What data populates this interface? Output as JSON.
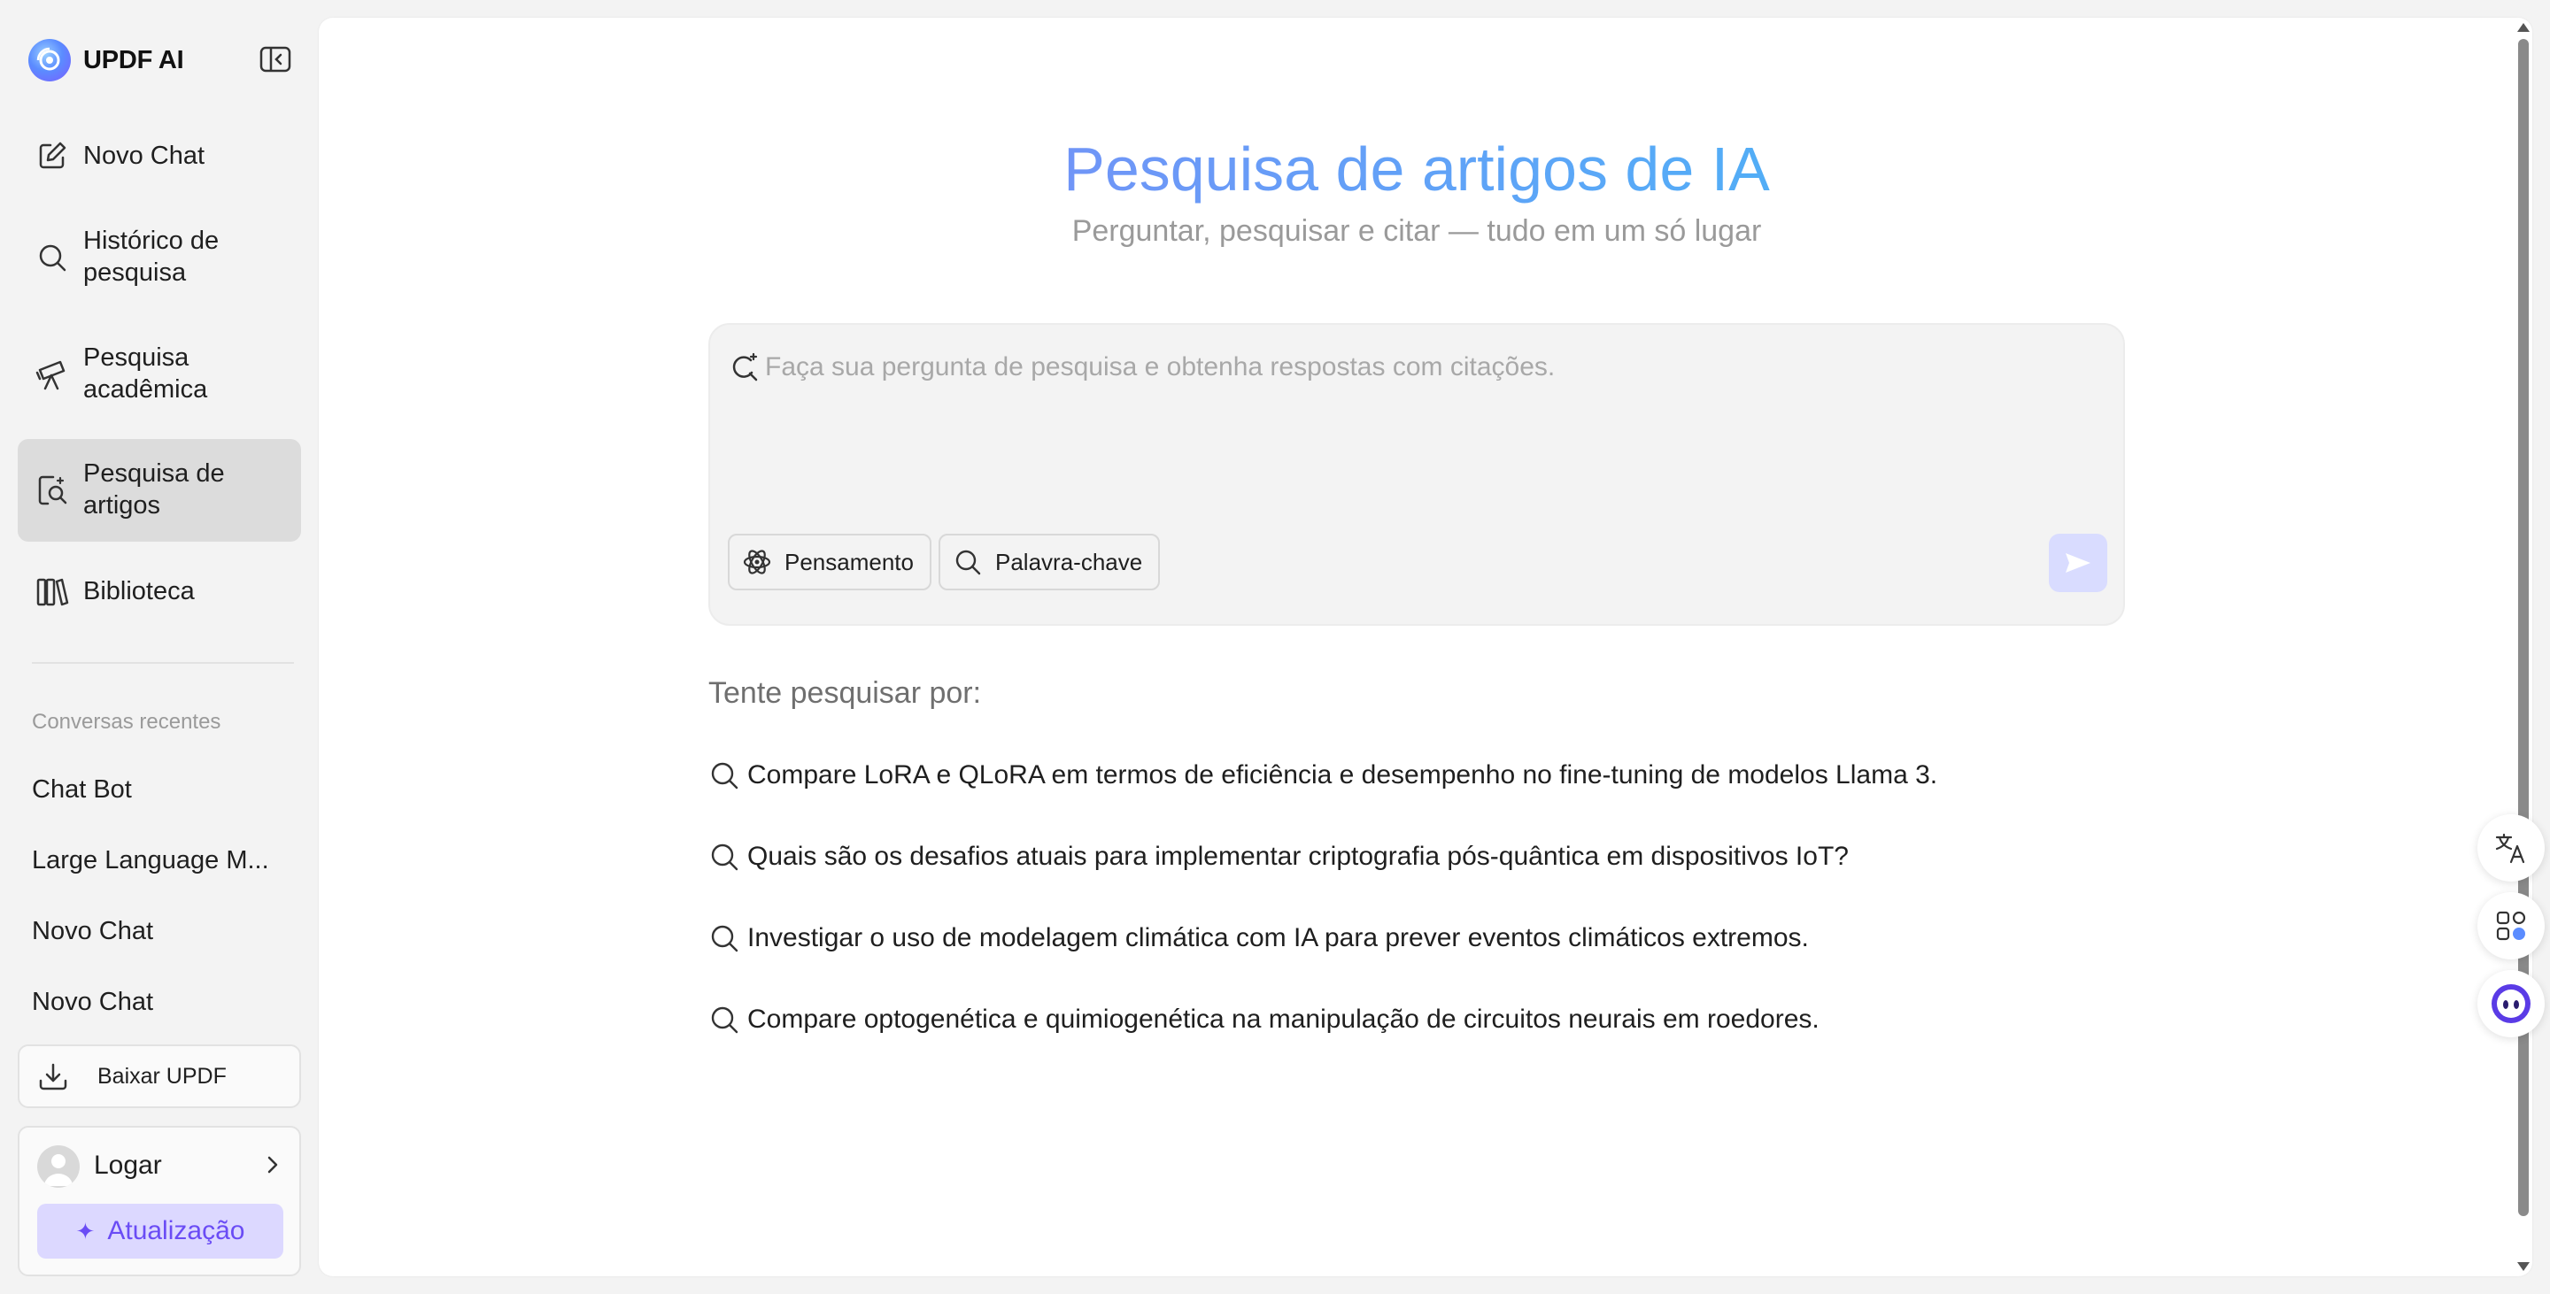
{
  "brand": {
    "name": "UPDF AI"
  },
  "sidebar": {
    "nav": [
      {
        "label": "Novo Chat",
        "icon": "edit-icon"
      },
      {
        "label": "Histórico de pesquisa",
        "icon": "search-icon"
      },
      {
        "label": "Pesquisa acadêmica",
        "icon": "telescope-icon"
      },
      {
        "label": "Pesquisa de artigos",
        "icon": "document-search-icon",
        "active": true
      },
      {
        "label": "Biblioteca",
        "icon": "library-icon"
      }
    ],
    "recent_title": "Conversas recentes",
    "recent": [
      "Chat Bot",
      "Large Language M...",
      "Novo Chat",
      "Novo Chat"
    ],
    "download_label": "Baixar UPDF",
    "login_label": "Logar",
    "upgrade_label": "Atualização"
  },
  "main": {
    "title": "Pesquisa de artigos de IA",
    "subtitle": "Perguntar, pesquisar e citar — tudo em um só lugar",
    "search": {
      "placeholder": "Faça sua pergunta de pesquisa e obtenha respostas com citações.",
      "value": ""
    },
    "chips": {
      "thinking": "Pensamento",
      "keyword": "Palavra-chave"
    },
    "try_title": "Tente pesquisar por:",
    "suggestions": [
      "Compare LoRA e QLoRA em termos de eficiência e desempenho no fine-tuning de modelos Llama 3.",
      "Quais são os desafios atuais para implementar criptografia pós-quântica em dispositivos IoT?",
      "Investigar o uso de modelagem climática com IA para prever eventos climáticos extremos.",
      "Compare optogenética e quimiogenética na manipulação de circuitos neurais em roedores."
    ]
  },
  "colors": {
    "accent": "#6a4cf5",
    "title_gradient_start": "#8f7bf7",
    "title_gradient_end": "#2fc6f2",
    "send_button_bg": "#d9dcff",
    "active_nav_bg": "#dcdcdc"
  }
}
